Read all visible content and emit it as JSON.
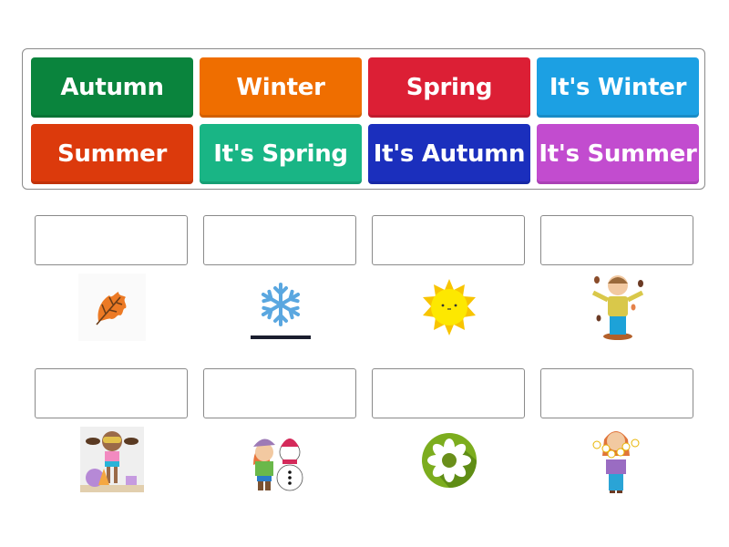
{
  "word_bank": {
    "tiles": [
      {
        "label": "Autumn",
        "color": "#0a843d"
      },
      {
        "label": "Winter",
        "color": "#ef6e00"
      },
      {
        "label": "Spring",
        "color": "#dc1f35"
      },
      {
        "label": "It's Winter",
        "color": "#1ca0e3"
      },
      {
        "label": "Summer",
        "color": "#dc3a0c"
      },
      {
        "label": "It's Spring",
        "color": "#19b585"
      },
      {
        "label": "It's Autumn",
        "color": "#1b2fbd"
      },
      {
        "label": "It's Summer",
        "color": "#c24ccf"
      }
    ]
  },
  "targets": [
    {
      "value": "",
      "image": "autumn-leaf"
    },
    {
      "value": "",
      "image": "snowflake"
    },
    {
      "value": "",
      "image": "sun"
    },
    {
      "value": "",
      "image": "boy-with-falling-leaves"
    },
    {
      "value": "",
      "image": "girl-at-beach"
    },
    {
      "value": "",
      "image": "girl-with-snowman"
    },
    {
      "value": "",
      "image": "flower-badge"
    },
    {
      "value": "",
      "image": "girl-with-flowers"
    }
  ]
}
